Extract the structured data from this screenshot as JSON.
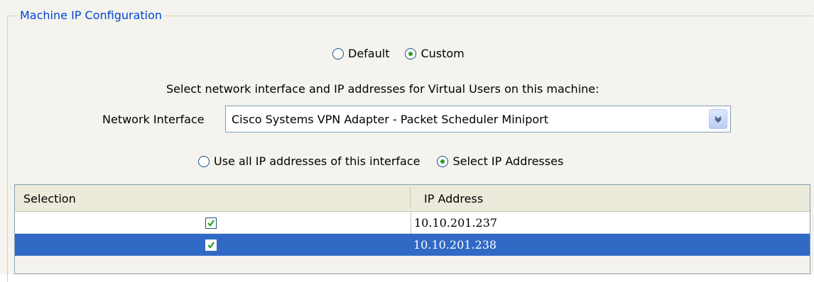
{
  "group": {
    "title": "Machine IP Configuration"
  },
  "mode": {
    "default_label": "Default",
    "custom_label": "Custom",
    "selected": "Custom"
  },
  "prompt": "Select network interface and IP addresses for Virtual Users on this machine:",
  "network_interface": {
    "label": "Network Interface",
    "value": "Cisco Systems VPN Adapter - Packet Scheduler Miniport"
  },
  "ip_mode": {
    "use_all_label": "Use all IP addresses of this interface",
    "select_label": "Select IP Addresses",
    "selected": "Select IP Addresses"
  },
  "table": {
    "columns": [
      "Selection",
      "IP Address"
    ],
    "rows": [
      {
        "selected": true,
        "ip": "10.10.201.237",
        "highlighted": false
      },
      {
        "selected": true,
        "ip": "10.10.201.238",
        "highlighted": true
      }
    ]
  },
  "colors": {
    "group_title": "#0046d5",
    "selection_highlight": "#316ac5",
    "radio_dot": "#21a121",
    "checkmark": "#21a121"
  }
}
